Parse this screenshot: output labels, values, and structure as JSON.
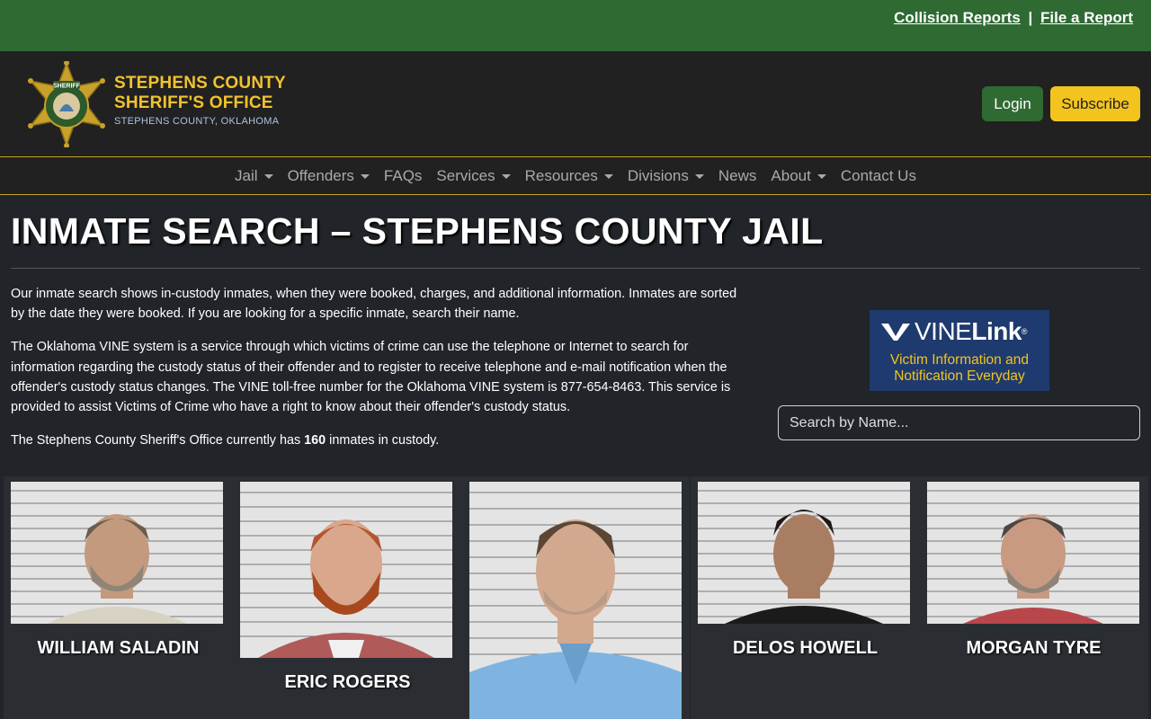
{
  "topbar": {
    "collision_reports": "Collision Reports",
    "separator": "|",
    "file_report": "File a Report"
  },
  "header": {
    "line1": "STEPHENS COUNTY",
    "line2": "SHERIFF'S OFFICE",
    "line3": "STEPHENS COUNTY, OKLAHOMA",
    "badge_text": "SHERIFF",
    "login": "Login",
    "subscribe": "Subscribe"
  },
  "nav": [
    {
      "label": "Jail",
      "dropdown": true
    },
    {
      "label": "Offenders",
      "dropdown": true
    },
    {
      "label": "FAQs",
      "dropdown": false
    },
    {
      "label": "Services",
      "dropdown": true
    },
    {
      "label": "Resources",
      "dropdown": true
    },
    {
      "label": "Divisions",
      "dropdown": true
    },
    {
      "label": "News",
      "dropdown": false
    },
    {
      "label": "About",
      "dropdown": true
    },
    {
      "label": "Contact Us",
      "dropdown": false
    }
  ],
  "page": {
    "title": "INMATE SEARCH – STEPHENS COUNTY JAIL",
    "p1": "Our inmate search shows in-custody inmates, when they were booked, charges, and additional information. Inmates are sorted by the date they were booked. If you are looking for a specific inmate, search their name.",
    "p2": "The Oklahoma VINE system is a service through which victims of crime can use the telephone or Internet to search for information regarding the custody status of their offender and to register to receive telephone and e-mail notification when the offender's custody status changes. The VINE toll-free number for the Oklahoma VINE system is 877-654-8463. This service is provided to assist Victims of Crime who have a right to know about their offender's custody status.",
    "p3_before": "The Stephens County Sheriff's Office currently has ",
    "p3_count": "160",
    "p3_after": " inmates in custody."
  },
  "vine": {
    "brand_vine": "VINE",
    "brand_link": "Link",
    "reg": "®",
    "tagline1": "Victim Information and",
    "tagline2": "Notification Everyday"
  },
  "search": {
    "placeholder": "Search by Name..."
  },
  "inmates": [
    {
      "name": "WILLIAM SALADIN",
      "shirt": "#d8d2c4",
      "skin": "#c39a7e",
      "hair": "#6b5c4d",
      "beard": "#8f8577"
    },
    {
      "name": "ERIC ROGERS",
      "shirt": "#b05a5a",
      "skin": "#d9a78c",
      "hair": "#b4542e",
      "beard": "#a8481f"
    },
    {
      "name": "",
      "shirt": "#7fb4e0",
      "skin": "#d2a88f",
      "hair": "#5b4636",
      "beard": "#b89a86"
    },
    {
      "name": "DELOS HOWELL",
      "shirt": "#1b1b1b",
      "skin": "#a87d62",
      "hair": "#1e1a18",
      "beard": "#a87d62"
    },
    {
      "name": "MORGAN TYRE",
      "shirt": "#b8474b",
      "skin": "#c89a82",
      "hair": "#4e4640",
      "beard": "#8e8378"
    }
  ],
  "colors": {
    "topbar": "#2f6a33",
    "header": "#212121",
    "accent_gold": "#f2c230",
    "subscribe": "#f3c41e",
    "body_bg": "#212529",
    "card_bg": "#2a2e33",
    "vine_bg": "#1f3a6e"
  }
}
